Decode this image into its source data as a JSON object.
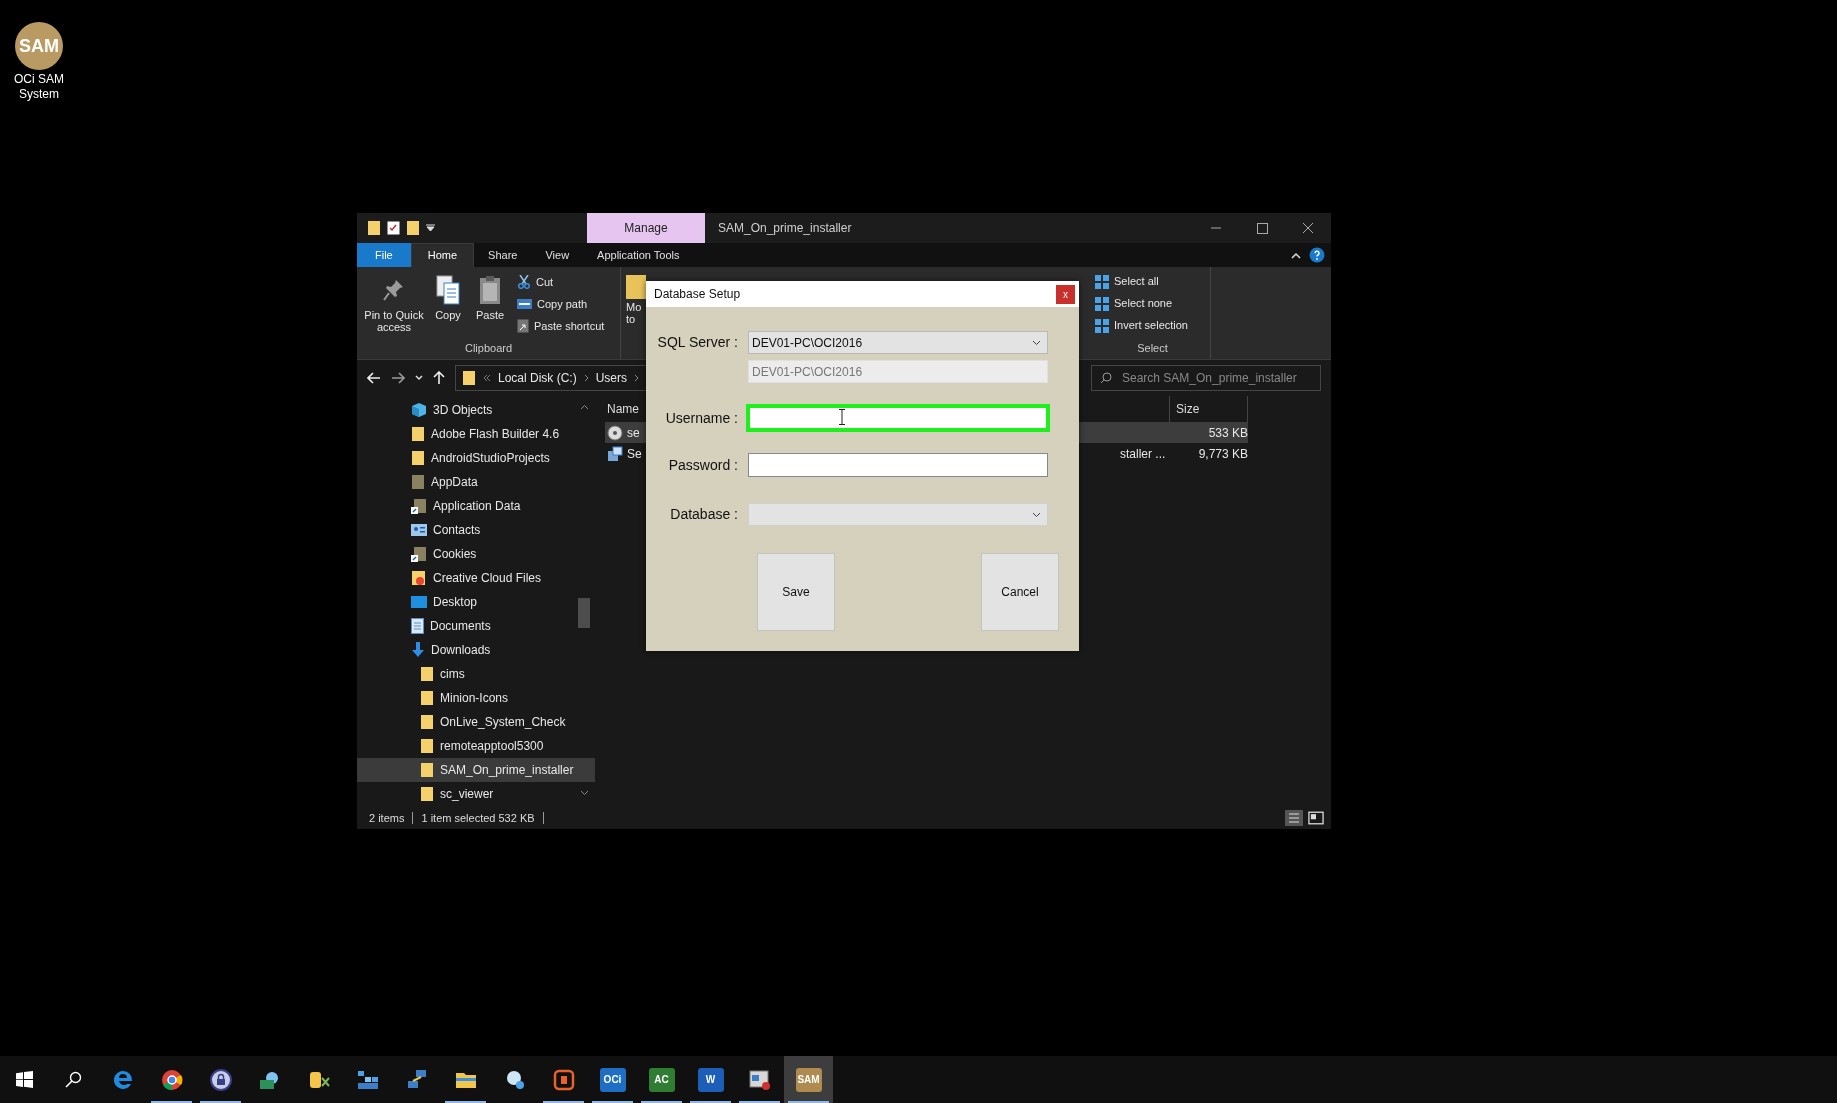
{
  "desktop_icons": [
    {
      "logo_text": "SAM",
      "label": "OCi SAM System"
    }
  ],
  "explorer": {
    "context_tab": "Manage",
    "title": "SAM_On_prime_installer",
    "tabs": [
      {
        "label": "File",
        "kind": "file",
        "selected": false
      },
      {
        "label": "Home",
        "kind": "tab",
        "selected": true
      },
      {
        "label": "Share",
        "kind": "tab",
        "selected": false
      },
      {
        "label": "View",
        "kind": "tab",
        "selected": false
      },
      {
        "label": "Application Tools",
        "kind": "tab",
        "selected": false
      }
    ],
    "ribbon": {
      "clipboard": {
        "large": [
          {
            "label": "Pin to Quick access",
            "kind": "pin"
          },
          {
            "label": "Copy",
            "kind": "copy"
          },
          {
            "label": "Paste",
            "kind": "paste"
          }
        ],
        "small": [
          {
            "label": "Cut",
            "kind": "cut"
          },
          {
            "label": "Copy path",
            "kind": "path"
          },
          {
            "label": "Paste shortcut",
            "kind": "shortcut"
          }
        ],
        "group": "Clipboard"
      },
      "cut_group": {
        "lines": [
          "Mo",
          "to"
        ]
      },
      "select": {
        "items": [
          "Select all",
          "Select none",
          "Invert selection"
        ],
        "group": "Select"
      }
    },
    "address": {
      "crumbs": [
        "Local Disk (C:)",
        "Users"
      ]
    },
    "search": {
      "placeholder": "Search SAM_On_prime_installer"
    },
    "nav": [
      {
        "label": "3D Objects",
        "kind": "cube"
      },
      {
        "label": "Adobe Flash Builder 4.6",
        "kind": "folder"
      },
      {
        "label": "AndroidStudioProjects",
        "kind": "folder"
      },
      {
        "label": "AppData",
        "kind": "system"
      },
      {
        "label": "Application Data",
        "kind": "link"
      },
      {
        "label": "Contacts",
        "kind": "contacts"
      },
      {
        "label": "Cookies",
        "kind": "link"
      },
      {
        "label": "Creative Cloud Files",
        "kind": "cloud"
      },
      {
        "label": "Desktop",
        "kind": "desktop"
      },
      {
        "label": "Documents",
        "kind": "documents"
      },
      {
        "label": "Downloads",
        "kind": "downloads",
        "children": [
          {
            "label": "cims",
            "kind": "folder",
            "selected": false
          },
          {
            "label": "Minion-Icons",
            "kind": "folder",
            "selected": false
          },
          {
            "label": "OnLive_System_Check",
            "kind": "folder",
            "selected": false
          },
          {
            "label": "remoteapptool5300",
            "kind": "folder",
            "selected": false
          },
          {
            "label": "SAM_On_prime_installer",
            "kind": "folder",
            "selected": true
          },
          {
            "label": "sc_viewer",
            "kind": "folder",
            "selected": false
          }
        ]
      }
    ],
    "columns": {
      "name": "Name",
      "size": "Size"
    },
    "files": [
      {
        "name": "se",
        "kind": "setup",
        "size": "533 KB",
        "selected": true
      },
      {
        "name": "Se",
        "kind": "package",
        "column_3": "staller ...",
        "size": "9,773 KB",
        "selected": false
      }
    ],
    "status": [
      "2 items",
      "1 item selected 532 KB"
    ]
  },
  "dialog": {
    "title": "Database Setup",
    "close": "x",
    "sql_server": {
      "label": "SQL Server :",
      "value": "DEV01-PC\\OCI2016",
      "display": "DEV01-PC\\OCI2016"
    },
    "username": {
      "label": "Username :",
      "focused": true
    },
    "password": {
      "label": "Password :"
    },
    "database": {
      "label": "Database :"
    },
    "buttons": [
      "Save",
      "Cancel"
    ]
  },
  "taskbar": [
    {
      "kind": "edge",
      "open": false,
      "selected": false
    },
    {
      "kind": "chrome",
      "open": true,
      "selected": false
    },
    {
      "kind": "lock",
      "open": true,
      "selected": false
    },
    {
      "kind": "cloud",
      "open": false,
      "selected": false
    },
    {
      "kind": "db",
      "open": false,
      "selected": false
    },
    {
      "kind": "grid",
      "open": false,
      "selected": false
    },
    {
      "kind": "network",
      "open": false,
      "selected": false
    },
    {
      "kind": "folder",
      "open": true,
      "selected": false
    },
    {
      "kind": "globe",
      "open": false,
      "selected": false
    },
    {
      "kind": "orange",
      "open": true,
      "selected": false
    },
    {
      "kind": "logo",
      "logo_text": "OCi",
      "color": "#1e6fc4",
      "open": true,
      "selected": false
    },
    {
      "kind": "logo",
      "logo_text": "AC",
      "color": "#2e7d32",
      "open": true,
      "selected": false
    },
    {
      "kind": "logo",
      "logo_text": "W",
      "color": "#1d5fb8",
      "open": true,
      "selected": false
    },
    {
      "kind": "window",
      "open": true,
      "selected": false
    },
    {
      "kind": "logo",
      "logo_text": "SAM",
      "color": "#b08b4f",
      "open": true,
      "selected": true
    }
  ]
}
